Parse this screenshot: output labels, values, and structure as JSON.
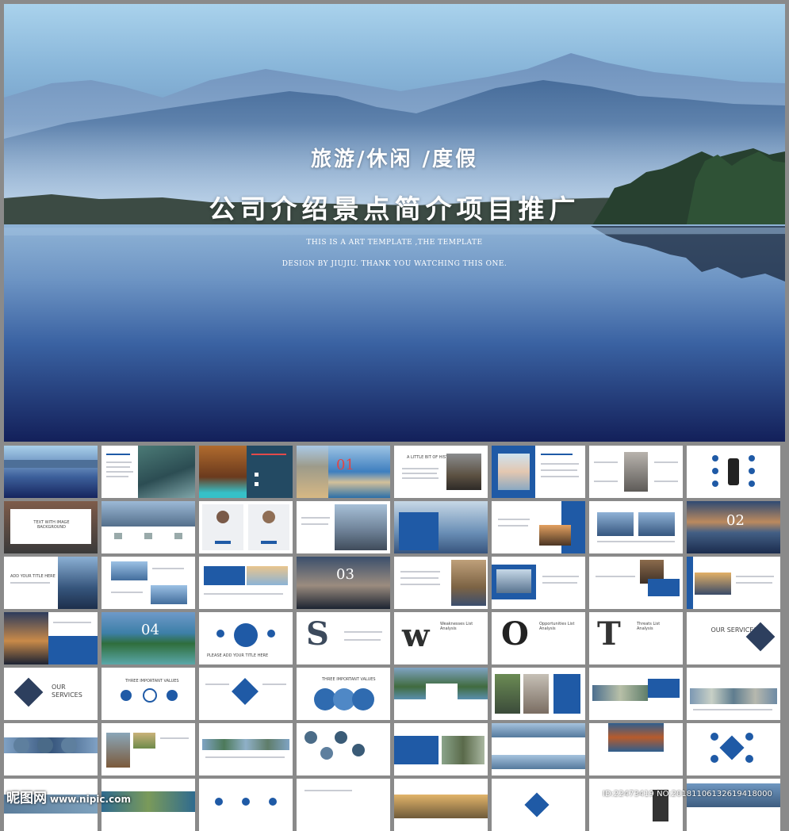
{
  "hero": {
    "subtitle": "旅游/休闲 /度假",
    "title": "公司介绍景点简介项目推广",
    "english_line1": "THIS IS A ART TEMPLATE ,THE TEMPLATE",
    "english_line2": "DESIGN BY JIUJIU. THANK YOU WATCHING THIS ONE."
  },
  "thumbnails": {
    "section_01": "01",
    "section_02": "02",
    "section_03": "03",
    "section_04": "04",
    "add_title": "ADD YOUR TITLE HERE",
    "please_add": "PLEASE ADD YOUR TITLE HERE",
    "text_with_image": "TEXT WITH IMAGE BACKGROUND",
    "a_little_history": "A LITTLE BIT OF HISTORY",
    "our_services_1": "OUR SERVICES",
    "our_services_2": "OUR SERVICES",
    "weakness": "Weaknesses List Analysis",
    "opportunities": "Opportunities List Analysis",
    "threats": "Threats List Analysis",
    "three_important_1": "THREE IMPORTANT VALUES",
    "three_important_2": "THREE IMPORTANT VALUES",
    "swot_s": "S",
    "swot_w": "w",
    "swot_o": "O",
    "swot_t": "T"
  },
  "watermark": {
    "logo": "昵图网",
    "site": "www.nipic.com",
    "id": "ID:22473419 NO:20181106132619418000"
  },
  "colors": {
    "accent_blue": "#1f5aa6",
    "dark_navy": "#14225a"
  }
}
